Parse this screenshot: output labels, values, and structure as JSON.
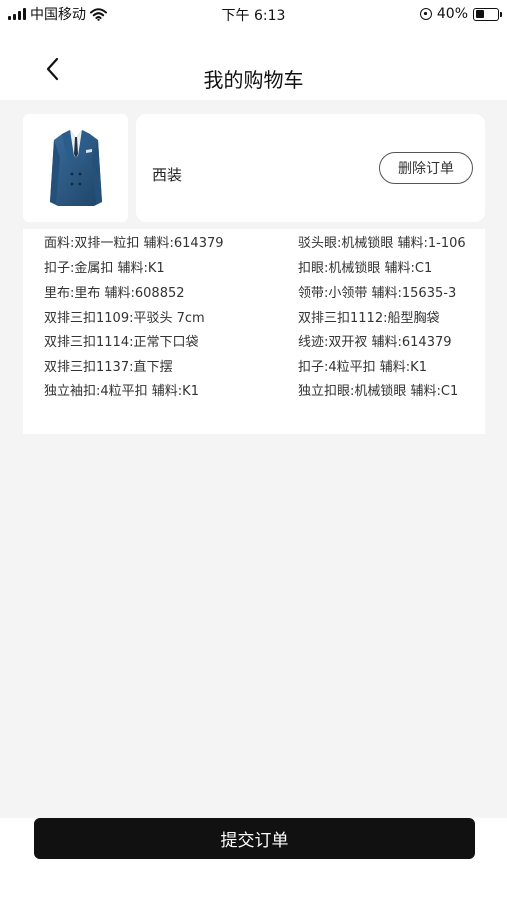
{
  "status_bar": {
    "carrier": "中国移动",
    "time": "下午 6:13",
    "battery": "40%",
    "battery_level": 0.4,
    "icons": [
      "signal-icon",
      "wifi-icon",
      "rotation-lock-icon",
      "battery-icon"
    ]
  },
  "nav": {
    "title": "我的购物车",
    "back_icon": "chevron-left-icon"
  },
  "cart_item": {
    "name": "西装",
    "delete_label": "删除订单",
    "image": "suit-jacket-image"
  },
  "specs": {
    "rows": [
      {
        "left": "面料:双排一粒扣 辅料:614379",
        "right": "驳头眼:机械锁眼 辅料:1-106"
      },
      {
        "left": "扣子:金属扣 辅料:K1",
        "right": "扣眼:机械锁眼 辅料:C1"
      },
      {
        "left": "里布:里布 辅料:608852",
        "right": "领带:小领带 辅料:15635-3"
      },
      {
        "left": "双排三扣1109:平驳头 7cm",
        "right": "双排三扣1112:船型胸袋"
      },
      {
        "left": "双排三扣1114:正常下口袋",
        "right": "线迹:双开衩 辅料:614379"
      },
      {
        "left": "双排三扣1137:直下摆",
        "right": "扣子:4粒平扣 辅料:K1"
      },
      {
        "left": "独立袖扣:4粒平扣 辅料:K1",
        "right": "独立扣眼:机械锁眼 辅料:C1"
      }
    ]
  },
  "footer": {
    "submit_label": "提交订单"
  },
  "colors": {
    "background": "#f4f4f4",
    "button": "#111111",
    "suit": "#2d5a86"
  }
}
